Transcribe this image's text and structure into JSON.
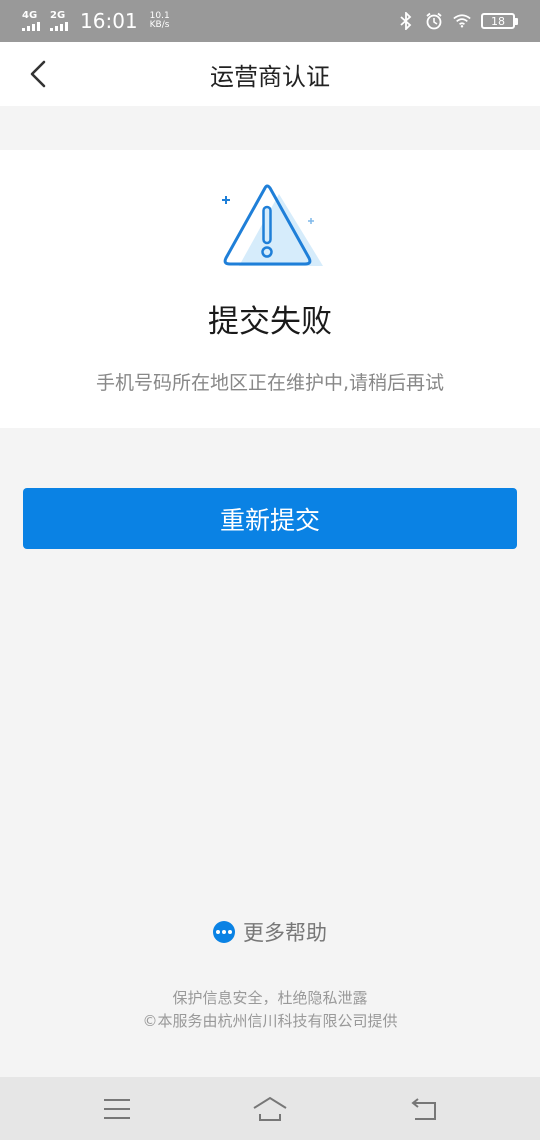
{
  "status_bar": {
    "network1": "4G",
    "network2": "2G",
    "time": "16:01",
    "speed_value": "10.1",
    "speed_unit": "KB/s",
    "battery": "18",
    "icons": [
      "bluetooth-icon",
      "alarm-icon",
      "wifi-icon",
      "battery-icon"
    ]
  },
  "header": {
    "title": "运营商认证",
    "back_icon": "chevron-left-icon"
  },
  "result": {
    "icon": "warning-triangle-icon",
    "title": "提交失败",
    "message": "手机号码所在地区正在维护中,请稍后再试"
  },
  "actions": {
    "resubmit_label": "重新提交"
  },
  "help": {
    "icon": "more-dots-icon",
    "label": "更多帮助"
  },
  "footer": {
    "line1": "保护信息安全，杜绝隐私泄露",
    "line2": "©本服务由杭州信川科技有限公司提供"
  },
  "nav_bar": {
    "icons": [
      "menu-icon",
      "home-icon",
      "back-icon"
    ]
  },
  "colors": {
    "accent": "#0a82e4",
    "status_bar": "#999999",
    "background": "#f4f4f4",
    "icon_light": "#d6ecfb"
  }
}
